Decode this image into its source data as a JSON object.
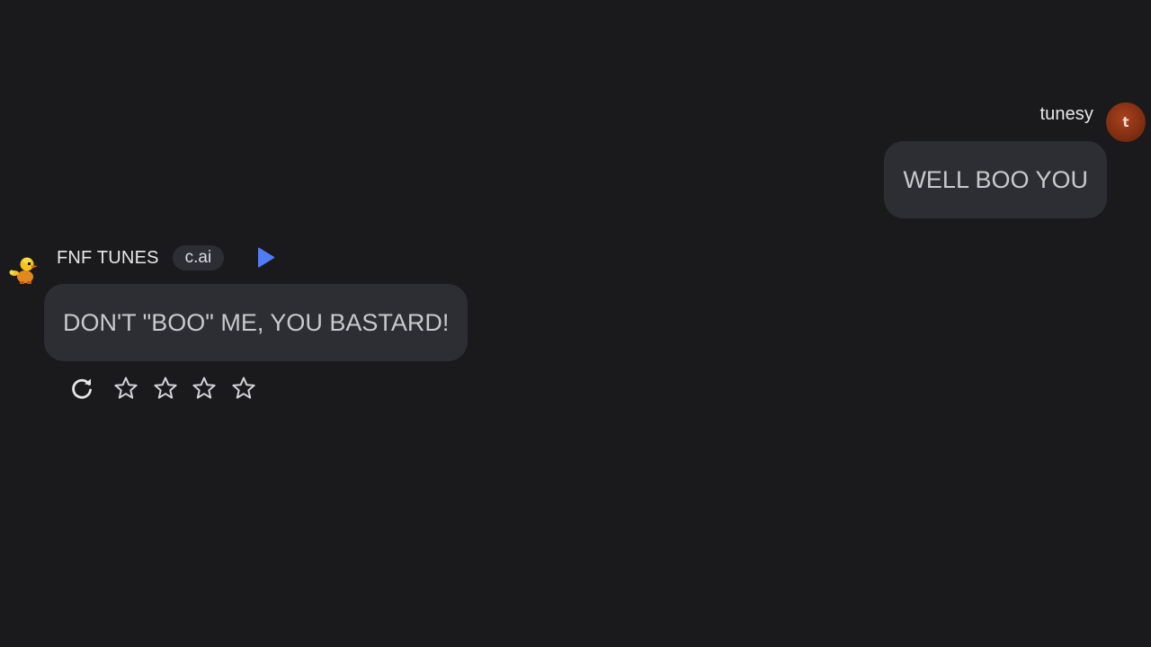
{
  "user_message": {
    "username": "tunesy",
    "avatar_initial": "t",
    "text": "WELL BOO YOU"
  },
  "bot_message": {
    "name": "FNF TUNES",
    "badge": "c.ai",
    "text": "DON'T \"BOO\" ME, YOU BASTARD!",
    "avatar_icon": "duck-character-icon",
    "play_icon": "play-icon"
  },
  "actions": {
    "regenerate_icon": "refresh-icon",
    "rating": {
      "max": 5,
      "value": 0,
      "icon": "star-outline-icon"
    }
  },
  "colors": {
    "background": "#1a1a1c",
    "bubble": "#2d2e33",
    "accent_play": "#4f7cf7",
    "avatar_user": "#8a3414"
  }
}
